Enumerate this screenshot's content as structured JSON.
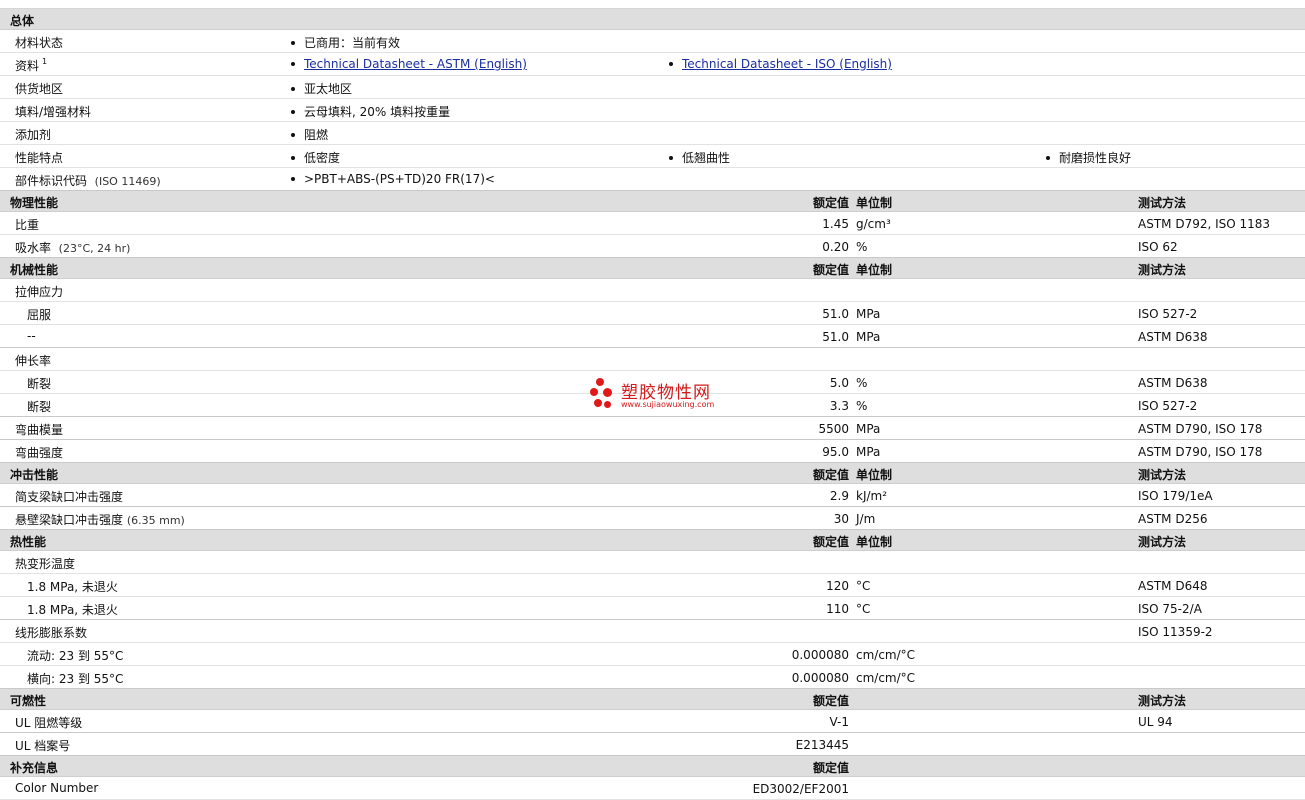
{
  "general": {
    "title": "总体",
    "material_status": {
      "label": "材料状态",
      "value": "已商用：当前有效"
    },
    "docs": {
      "label": "资料",
      "sup": "1",
      "link1": "Technical Datasheet - ASTM (English)",
      "link2": "Technical Datasheet - ISO (English)"
    },
    "supply": {
      "label": "供货地区",
      "value": "亚太地区"
    },
    "filler": {
      "label": "填料/增强材料",
      "value": "云母填料, 20% 填料按重量"
    },
    "additive": {
      "label": "添加剂",
      "value": "阻燃"
    },
    "features": {
      "label": "性能特点",
      "v1": "低密度",
      "v2": "低翘曲性",
      "v3": "耐磨损性良好"
    },
    "part_code": {
      "label": "部件标识代码",
      "note": "(ISO 11469)",
      "value": ">PBT+ABS-(PS+TD)20 FR(17)<"
    }
  },
  "headers": {
    "value": "额定值",
    "unit": "单位制",
    "method": "测试方法"
  },
  "physical": {
    "title": "物理性能",
    "rows": [
      {
        "label": "比重",
        "note": "",
        "value": "1.45",
        "unit": "g/cm³",
        "method": "ASTM D792, ISO 1183"
      },
      {
        "label": "吸水率",
        "note": "(23°C, 24 hr)",
        "value": "0.20",
        "unit": "%",
        "method": "ISO 62"
      }
    ]
  },
  "mechanical": {
    "title": "机械性能",
    "tensile": "拉伸应力",
    "tensile_rows": [
      {
        "label": "屈服",
        "value": "51.0",
        "unit": "MPa",
        "method": "ISO 527-2"
      },
      {
        "label": "--",
        "value": "51.0",
        "unit": "MPa",
        "method": "ASTM D638"
      }
    ],
    "elong": "伸长率",
    "elong_rows": [
      {
        "label": "断裂",
        "value": "5.0",
        "unit": "%",
        "method": "ASTM D638"
      },
      {
        "label": "断裂",
        "value": "3.3",
        "unit": "%",
        "method": "ISO 527-2"
      }
    ],
    "flex_mod": {
      "label": "弯曲模量",
      "value": "5500",
      "unit": "MPa",
      "method": "ASTM D790, ISO 178"
    },
    "flex_str": {
      "label": "弯曲强度",
      "value": "95.0",
      "unit": "MPa",
      "method": "ASTM D790, ISO 178"
    }
  },
  "impact": {
    "title": "冲击性能",
    "rows": [
      {
        "label": "简支梁缺口冲击强度",
        "note": "",
        "value": "2.9",
        "unit": "kJ/m²",
        "method": "ISO 179/1eA"
      },
      {
        "label": "悬壁梁缺口冲击强度",
        "note": "(6.35 mm)",
        "value": "30",
        "unit": "J/m",
        "method": "ASTM D256"
      }
    ]
  },
  "thermal": {
    "title": "热性能",
    "hdt": "热变形温度",
    "hdt_rows": [
      {
        "label": "1.8 MPa, 未退火",
        "value": "120",
        "unit": "°C",
        "method": "ASTM D648"
      },
      {
        "label": "1.8 MPa, 未退火",
        "value": "110",
        "unit": "°C",
        "method": "ISO 75-2/A"
      }
    ],
    "clte": {
      "label": "线形膨胀系数",
      "method": "ISO 11359-2"
    },
    "clte_rows": [
      {
        "label": "流动: 23 到  55°C",
        "value": "0.000080",
        "unit": "cm/cm/°C"
      },
      {
        "label": "横向: 23 到  55°C",
        "value": "0.000080",
        "unit": "cm/cm/°C"
      }
    ]
  },
  "flammability": {
    "title": "可燃性",
    "rows": [
      {
        "label": "UL 阻燃等级",
        "value": "V-1",
        "method": "UL 94"
      },
      {
        "label": "UL 档案号",
        "value": "E213445",
        "method": ""
      }
    ]
  },
  "supplemental": {
    "title": "补充信息",
    "rows": [
      {
        "label": "Color Number",
        "value": "ED3002/EF2001"
      }
    ]
  },
  "watermark": {
    "text": "塑胶物性网",
    "url": "www.sujiaowuxing.com",
    "color": "#e01818"
  }
}
